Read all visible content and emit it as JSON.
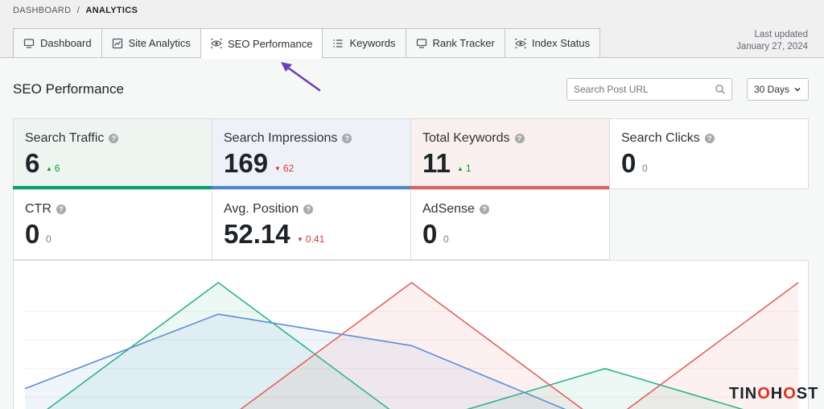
{
  "breadcrumb": {
    "root": "DASHBOARD",
    "sep": "/",
    "current": "ANALYTICS"
  },
  "tabs": [
    {
      "label": "Dashboard",
      "icon": "monitor-icon"
    },
    {
      "label": "Site Analytics",
      "icon": "chart-icon"
    },
    {
      "label": "SEO Performance",
      "icon": "eye-icon",
      "active": true
    },
    {
      "label": "Keywords",
      "icon": "list-icon"
    },
    {
      "label": "Rank Tracker",
      "icon": "monitor-icon"
    },
    {
      "label": "Index Status",
      "icon": "eye-icon"
    }
  ],
  "last_updated": {
    "label": "Last updated",
    "date": "January 27, 2024"
  },
  "page_title": "SEO Performance",
  "search": {
    "placeholder": "Search Post URL"
  },
  "range": {
    "selected": "30 Days"
  },
  "metrics": [
    {
      "label": "Search Traffic",
      "value": "6",
      "delta": "6",
      "dir": "up",
      "bg": "#eef5f1",
      "bar": "#00a36c"
    },
    {
      "label": "Search Impressions",
      "value": "169",
      "delta": "62",
      "dir": "down",
      "bg": "#eef1f7",
      "bar": "#4a88d6"
    },
    {
      "label": "Total Keywords",
      "value": "11",
      "delta": "1",
      "dir": "up",
      "bg": "#f9efef",
      "bar": "#e06060"
    },
    {
      "label": "Search Clicks",
      "value": "0",
      "delta": "0",
      "dir": "flat",
      "bg": "#ffffff",
      "bar": ""
    },
    {
      "label": "CTR",
      "value": "0",
      "delta": "0",
      "dir": "flat",
      "bg": "#ffffff",
      "bar": ""
    },
    {
      "label": "Avg. Position",
      "value": "52.14",
      "delta": "0.41",
      "dir": "down",
      "bg": "#ffffff",
      "bar": ""
    },
    {
      "label": "AdSense",
      "value": "0",
      "delta": "0",
      "dir": "flat",
      "bg": "#ffffff",
      "bar": ""
    }
  ],
  "chart_data": {
    "type": "line",
    "x": [
      0,
      1,
      2,
      3,
      4
    ],
    "ylim": [
      0,
      5
    ],
    "grid": true,
    "series": [
      {
        "color": "#2fb389",
        "values": [
          0,
          5,
          0,
          2,
          0
        ]
      },
      {
        "color": "#5b8dd9",
        "values": [
          1.3,
          3.9,
          2.8,
          0,
          0
        ]
      },
      {
        "color": "#e2625e",
        "values": [
          0,
          0,
          5,
          0,
          5
        ]
      }
    ]
  },
  "watermark": {
    "pre": "TIN",
    "o": "O",
    "post": "H",
    "o2": "O",
    "end": "ST"
  }
}
